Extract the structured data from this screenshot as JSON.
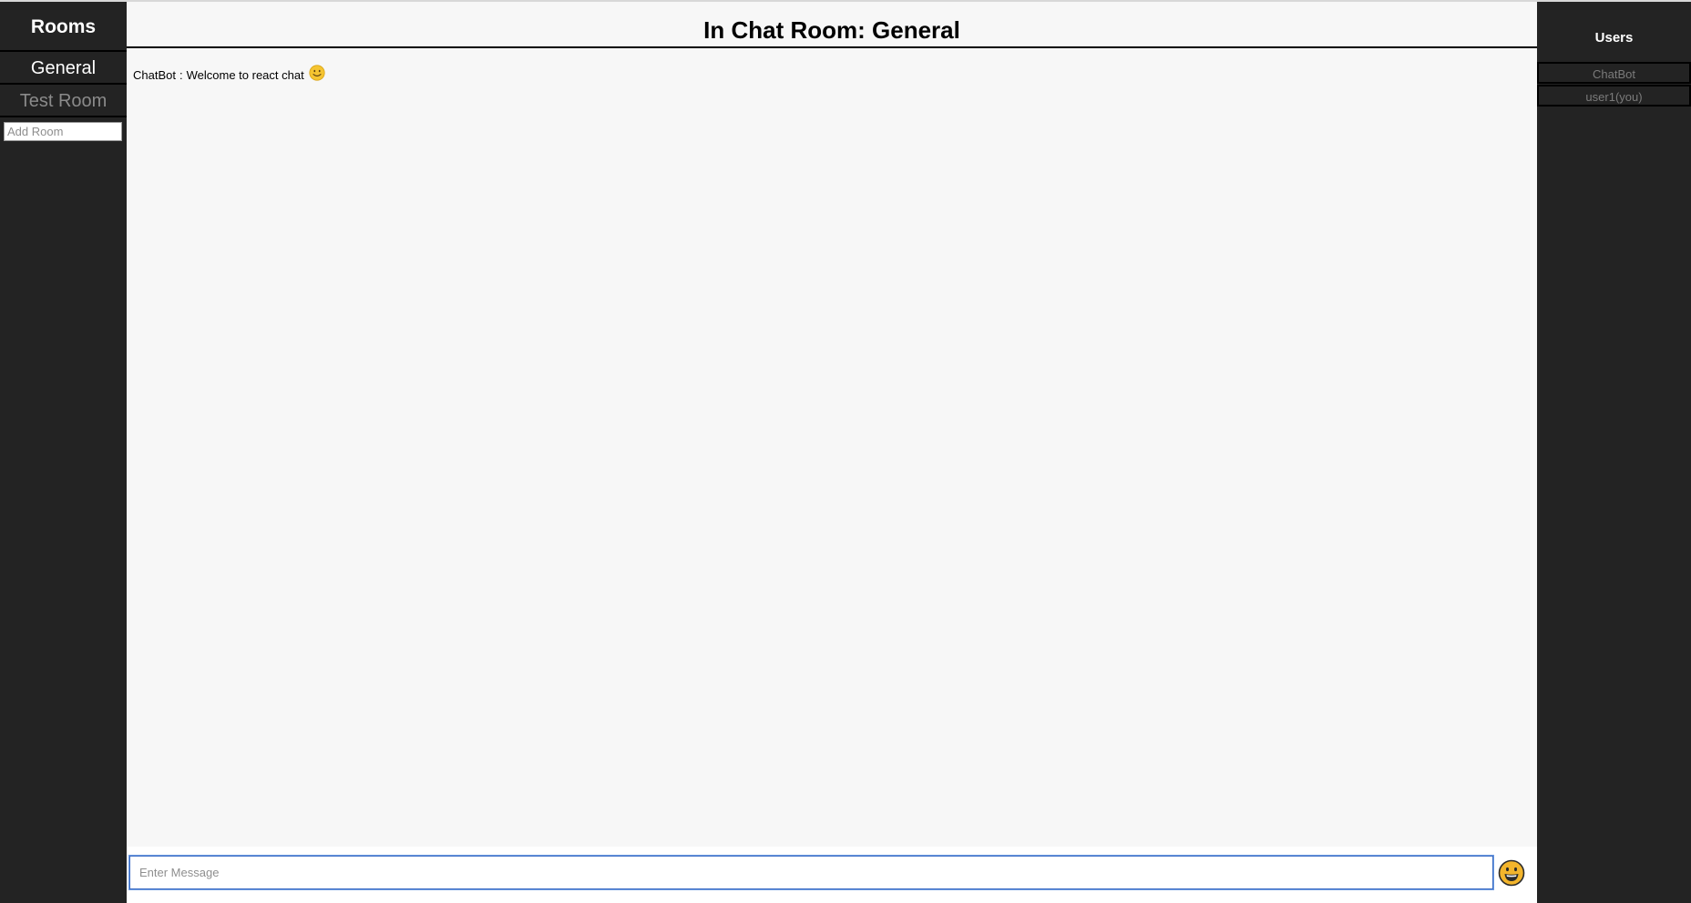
{
  "sidebar": {
    "title": "Rooms",
    "rooms": [
      {
        "label": "General",
        "active": true
      },
      {
        "label": "Test Room",
        "active": false
      }
    ],
    "add_room_placeholder": "Add Room"
  },
  "header": {
    "title": "In Chat Room: General"
  },
  "messages": [
    {
      "author": "ChatBot",
      "separator": ":",
      "text": "Welcome to react chat",
      "emoji": "slightly-smiling-face"
    }
  ],
  "composer": {
    "placeholder": "Enter Message",
    "emoji_button_icon": "grinning-face-icon"
  },
  "users_panel": {
    "title": "Users",
    "users": [
      "ChatBot",
      "user1(you)"
    ]
  },
  "colors": {
    "sidebar_bg": "#232323",
    "main_bg": "#f7f7f7",
    "active_room": "#ffffff",
    "inactive_room": "#8a8a8a",
    "emoji_yellow": "#f5c431"
  }
}
